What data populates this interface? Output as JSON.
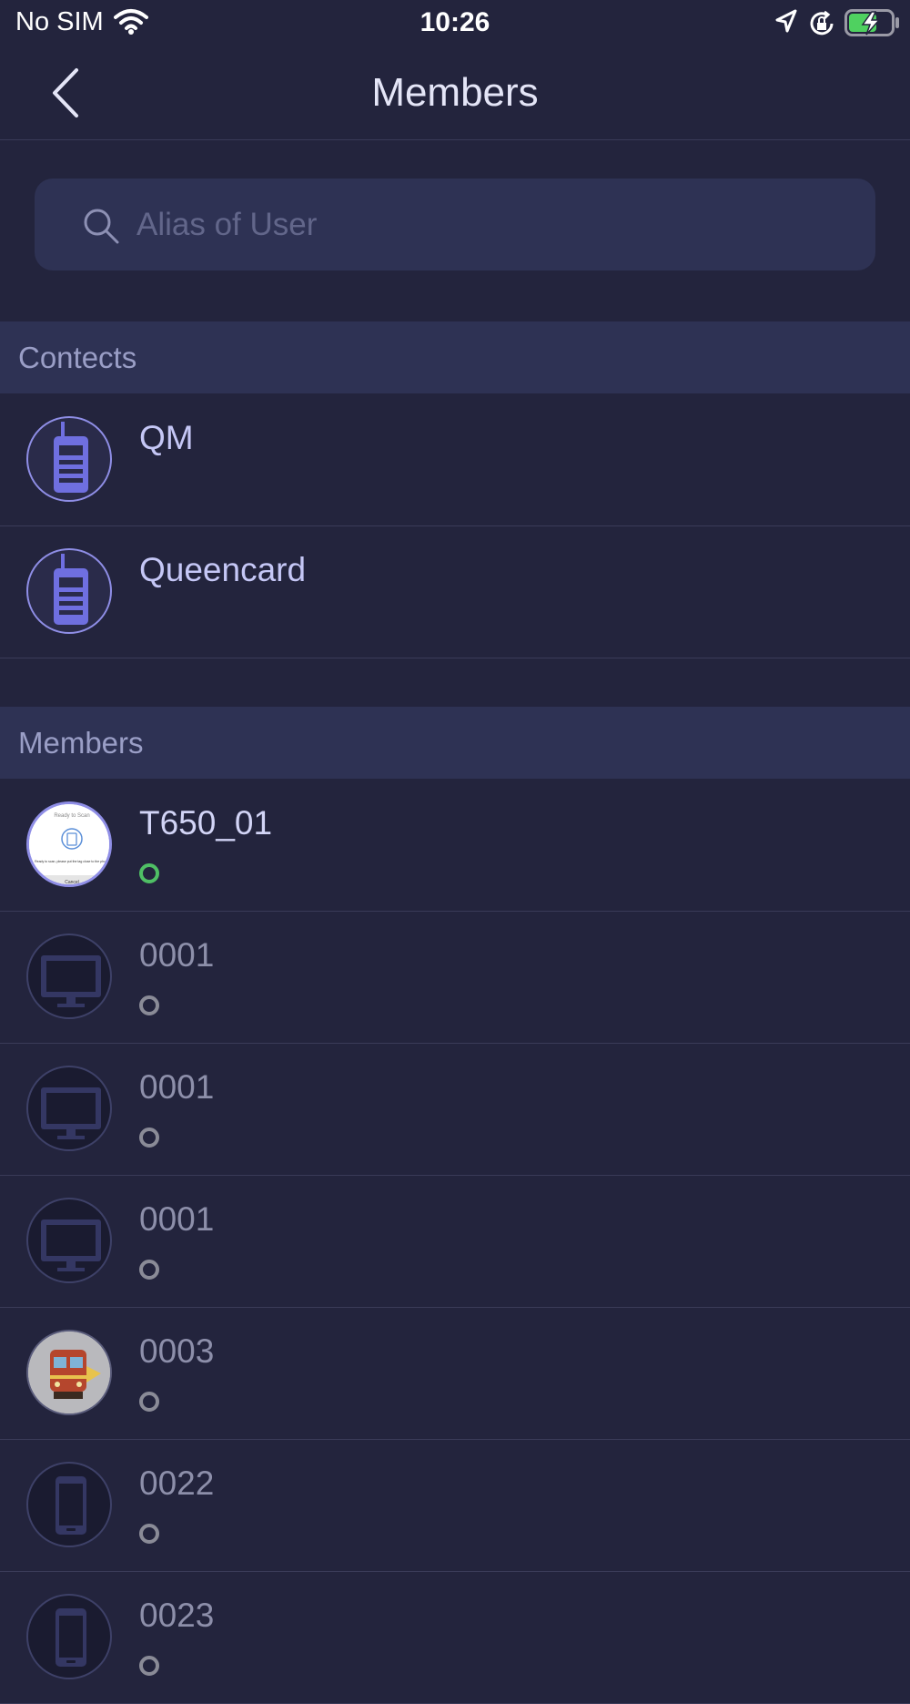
{
  "status_bar": {
    "carrier": "No SIM",
    "time": "10:26"
  },
  "nav": {
    "title": "Members"
  },
  "search": {
    "placeholder": "Alias of User",
    "value": ""
  },
  "contacts_section": {
    "title": "Contects",
    "items": [
      {
        "name": "QM",
        "icon": "walkie-talkie-icon"
      },
      {
        "name": "Queencard",
        "icon": "walkie-talkie-icon"
      }
    ]
  },
  "members_section": {
    "title": "Members",
    "items": [
      {
        "name": "T650_01",
        "status": "online",
        "avatar": "screenshot-thumbnail"
      },
      {
        "name": "0001",
        "status": "offline",
        "avatar": "monitor-icon"
      },
      {
        "name": "0001",
        "status": "offline",
        "avatar": "monitor-icon"
      },
      {
        "name": "0001",
        "status": "offline",
        "avatar": "monitor-icon"
      },
      {
        "name": "0003",
        "status": "offline",
        "avatar": "train-image"
      },
      {
        "name": "0022",
        "status": "offline",
        "avatar": "phone-icon"
      },
      {
        "name": "0023",
        "status": "offline",
        "avatar": "phone-icon"
      }
    ]
  },
  "thumbnail_text": {
    "title": "Ready to Scan",
    "body": "Ready to scan, please put the tag close to the phone",
    "cancel": "Cancel"
  },
  "colors": {
    "background": "#23243d",
    "section_header": "#2e3254",
    "accent_purple": "#8f8ee6",
    "online": "#4fbf65",
    "offline": "#8a8b97"
  }
}
